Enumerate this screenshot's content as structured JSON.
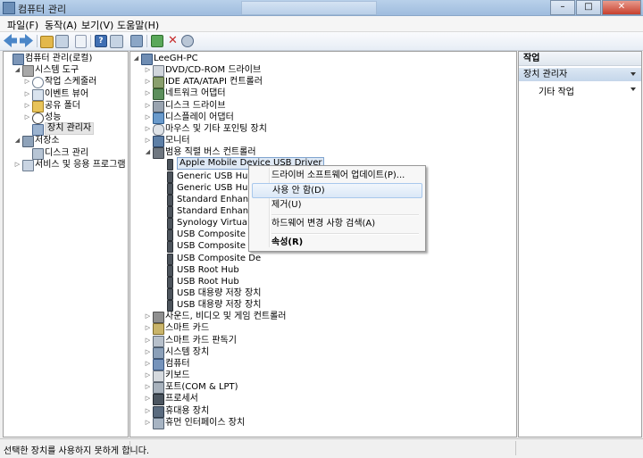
{
  "window": {
    "title": "컴퓨터 관리"
  },
  "menu": [
    "파일(F)",
    "동작(A)",
    "보기(V)",
    "도움말(H)"
  ],
  "left_tree": [
    {
      "label": "컴퓨터 관리(로컬)",
      "icon": "computer-mgmt-icon",
      "level": 0,
      "expander": ""
    },
    {
      "label": "시스템 도구",
      "icon": "tools-icon",
      "level": 1,
      "expander": "◢"
    },
    {
      "label": "작업 스케줄러",
      "icon": "clock-icon",
      "level": 2,
      "expander": "▷"
    },
    {
      "label": "이벤트 뷰어",
      "icon": "event-icon",
      "level": 2,
      "expander": "▷"
    },
    {
      "label": "공유 폴더",
      "icon": "folder-icon",
      "level": 2,
      "expander": "▷"
    },
    {
      "label": "성능",
      "icon": "performance-icon",
      "level": 2,
      "expander": "▷"
    },
    {
      "label": "장치 관리자",
      "icon": "device-manager-icon",
      "level": 2,
      "expander": "",
      "selected": true
    },
    {
      "label": "저장소",
      "icon": "storage-icon",
      "level": 1,
      "expander": "◢"
    },
    {
      "label": "디스크 관리",
      "icon": "disk-icon",
      "level": 2,
      "expander": ""
    },
    {
      "label": "서비스 및 응용 프로그램",
      "icon": "services-icon",
      "level": 1,
      "expander": "▷"
    }
  ],
  "device_tree": [
    {
      "label": "LeeGH-PC",
      "icon": "pc-icon",
      "level": 0,
      "expander": "◢"
    },
    {
      "label": "DVD/CD-ROM 드라이브",
      "icon": "dvd-icon",
      "level": 1,
      "expander": "▷"
    },
    {
      "label": "IDE ATA/ATAPI 컨트롤러",
      "icon": "ide-icon",
      "level": 1,
      "expander": "▷"
    },
    {
      "label": "네트워크 어댑터",
      "icon": "network-icon",
      "level": 1,
      "expander": "▷"
    },
    {
      "label": "디스크 드라이브",
      "icon": "disk-drive-icon",
      "level": 1,
      "expander": "▷"
    },
    {
      "label": "디스플레이 어댑터",
      "icon": "display-icon",
      "level": 1,
      "expander": "▷"
    },
    {
      "label": "마우스 및 기타 포인팅 장치",
      "icon": "mouse-icon",
      "level": 1,
      "expander": "▷"
    },
    {
      "label": "모니터",
      "icon": "monitor-icon",
      "level": 1,
      "expander": "▷"
    },
    {
      "label": "범용 직렬 버스 컨트롤러",
      "icon": "usb-icon",
      "level": 1,
      "expander": "◢"
    },
    {
      "label": "Apple Mobile Device USB Driver",
      "icon": "usb-plug-icon",
      "level": 2,
      "expander": "",
      "selected": true
    },
    {
      "label": "Generic USB Hub",
      "icon": "usb-plug-icon",
      "level": 2,
      "expander": ""
    },
    {
      "label": "Generic USB Hub",
      "icon": "usb-plug-icon",
      "level": 2,
      "expander": ""
    },
    {
      "label": "Standard Enhanced",
      "icon": "usb-plug-icon",
      "level": 2,
      "expander": ""
    },
    {
      "label": "Standard Enhanced",
      "icon": "usb-plug-icon",
      "level": 2,
      "expander": ""
    },
    {
      "label": "Synology Virtual U",
      "icon": "usb-plug-icon",
      "level": 2,
      "expander": ""
    },
    {
      "label": "USB Composite De",
      "icon": "usb-plug-icon",
      "level": 2,
      "expander": ""
    },
    {
      "label": "USB Composite De",
      "icon": "usb-plug-icon",
      "level": 2,
      "expander": ""
    },
    {
      "label": "USB Composite De",
      "icon": "usb-plug-icon",
      "level": 2,
      "expander": ""
    },
    {
      "label": "USB Root Hub",
      "icon": "usb-plug-icon",
      "level": 2,
      "expander": ""
    },
    {
      "label": "USB Root Hub",
      "icon": "usb-plug-icon",
      "level": 2,
      "expander": ""
    },
    {
      "label": "USB 대용량 저장 장치",
      "icon": "usb-plug-icon",
      "level": 2,
      "expander": ""
    },
    {
      "label": "USB 대용량 저장 장치",
      "icon": "usb-plug-icon",
      "level": 2,
      "expander": ""
    },
    {
      "label": "사운드, 비디오 및 게임 컨트롤러",
      "icon": "sound-icon",
      "level": 1,
      "expander": "▷"
    },
    {
      "label": "스마트 카드",
      "icon": "smartcard-icon",
      "level": 1,
      "expander": "▷"
    },
    {
      "label": "스마트 카드 판독기",
      "icon": "card-reader-icon",
      "level": 1,
      "expander": "▷"
    },
    {
      "label": "시스템 장치",
      "icon": "system-icon",
      "level": 1,
      "expander": "▷"
    },
    {
      "label": "컴퓨터",
      "icon": "computer-icon",
      "level": 1,
      "expander": "▷"
    },
    {
      "label": "키보드",
      "icon": "keyboard-icon",
      "level": 1,
      "expander": "▷"
    },
    {
      "label": "포트(COM & LPT)",
      "icon": "port-icon",
      "level": 1,
      "expander": "▷"
    },
    {
      "label": "프로세서",
      "icon": "processor-icon",
      "level": 1,
      "expander": "▷"
    },
    {
      "label": "휴대용 장치",
      "icon": "portable-icon",
      "level": 1,
      "expander": "▷"
    },
    {
      "label": "휴먼 인터페이스 장치",
      "icon": "hid-icon",
      "level": 1,
      "expander": "▷"
    }
  ],
  "context_menu": [
    {
      "label": "드라이버 소프트웨어 업데이트(P)...",
      "highlighted": false
    },
    {
      "label": "사용 안 함(D)",
      "highlighted": true
    },
    {
      "label": "제거(U)",
      "highlighted": false
    },
    {
      "label": "하드웨어 변경 사항 검색(A)",
      "highlighted": false
    },
    {
      "label": "속성(R)",
      "highlighted": false,
      "bold": true
    }
  ],
  "actions": {
    "header": "작업",
    "section": "장치 관리자",
    "item": "기타 작업"
  },
  "status": {
    "text": "선택한 장치를 사용하지 못하게 합니다."
  },
  "colors": {
    "selection": "#dfe9f5",
    "accent": "#3b6ea5",
    "menu_highlight": "#dbe8f7"
  }
}
